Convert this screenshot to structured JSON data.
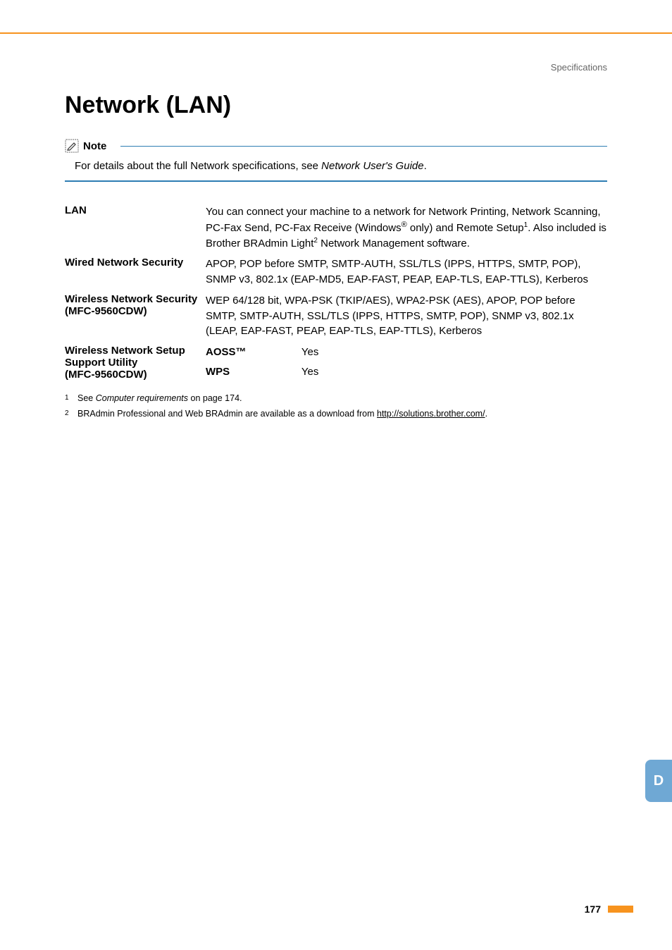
{
  "header": {
    "section": "Specifications"
  },
  "heading": "Network (LAN)",
  "note": {
    "label": "Note",
    "text_pre": "For details about the full Network specifications, see ",
    "text_em": "Network User's Guide",
    "text_post": "."
  },
  "specs": {
    "lan": {
      "label": "LAN",
      "line1": "You can connect your machine to a network for Network Printing, Network Scanning, PC-Fax Send, PC-Fax Receive (Windows",
      "reg": "®",
      "line1_post": " only) and Remote Setup",
      "sup1": "1",
      "line2": ". Also included is Brother BRAdmin Light",
      "sup2": "2",
      "line3": " Network Management software."
    },
    "wired": {
      "label": "Wired Network Security",
      "value": "APOP, POP before SMTP, SMTP-AUTH, SSL/TLS (IPPS, HTTPS, SMTP, POP), SNMP v3, 802.1x (EAP-MD5, EAP-FAST, PEAP, EAP-TLS, EAP-TTLS), Kerberos"
    },
    "wireless_sec": {
      "label1": "Wireless Network Security",
      "label2": "(MFC-9560CDW)",
      "value": "WEP 64/128 bit, WPA-PSK (TKIP/AES), WPA2-PSK (AES), APOP, POP before SMTP, SMTP-AUTH, SSL/TLS (IPPS, HTTPS, SMTP, POP), SNMP v3, 802.1x (LEAP, EAP-FAST, PEAP, EAP-TLS, EAP-TTLS), Kerberos"
    },
    "wireless_setup": {
      "label1": "Wireless Network Setup Support Utility",
      "label2": "(MFC-9560CDW)",
      "aoss_label": "AOSS™",
      "aoss_value": "Yes",
      "wps_label": "WPS",
      "wps_value": "Yes"
    }
  },
  "footnotes": {
    "f1": {
      "num": "1",
      "pre": "See ",
      "em": "Computer requirements",
      "post": " on page 174."
    },
    "f2": {
      "num": "2",
      "pre": "BRAdmin Professional and Web BRAdmin are available as a download from ",
      "link": "http://solutions.brother.com/",
      "post": "."
    }
  },
  "tab": "D",
  "page": "177"
}
